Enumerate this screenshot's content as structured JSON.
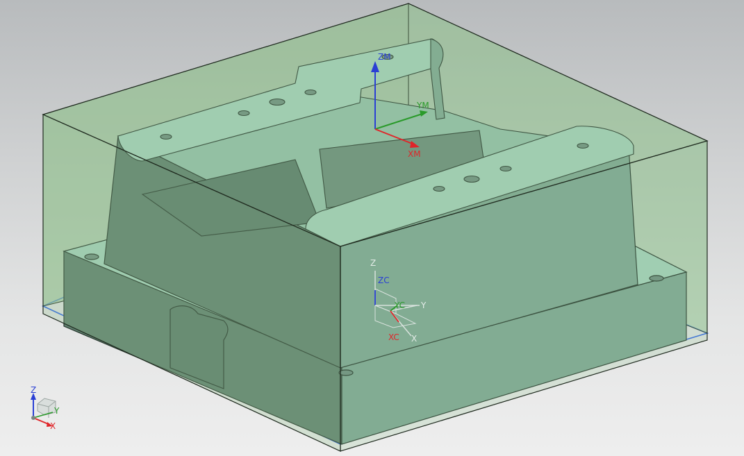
{
  "viewport": {
    "background_top": "#b8bbbd",
    "background_bottom": "#eeeeee"
  },
  "colors": {
    "blank_box_fill": "#8fc08c",
    "blank_box_edge": "#1f2a1f",
    "part_top": "#a6d2bd",
    "part_side_light": "#7fa795",
    "part_side_dark": "#5f7f6e",
    "part_edge": "#26352c",
    "floor_plane": "#2d63e8",
    "axis_x": "#e0262a",
    "axis_y": "#2a9a2a",
    "axis_z": "#2a3fd4"
  },
  "mcs_triad": {
    "x_label": "XM",
    "y_label": "YM",
    "z_label": "ZM"
  },
  "wcs_triad": {
    "x_label": "XC",
    "y_label": "YC",
    "z_label": "ZC",
    "x_abs_label": "X",
    "y_abs_label": "Y",
    "z_abs_label": "Z"
  },
  "view_triad": {
    "x_label": "X",
    "y_label": "Y",
    "z_label": "Z"
  }
}
